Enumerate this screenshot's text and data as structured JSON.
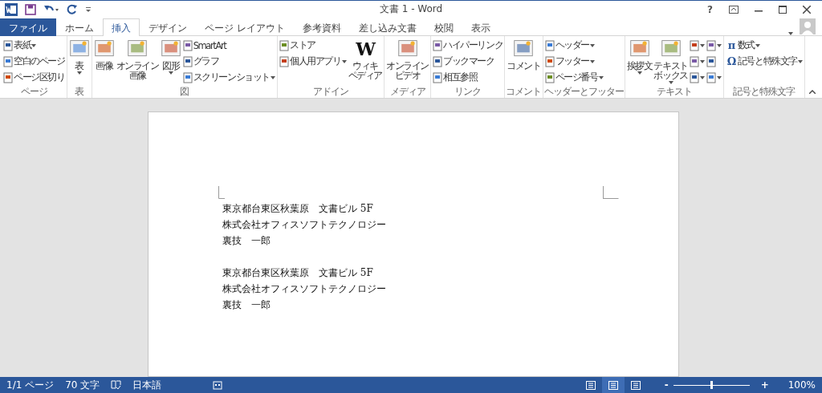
{
  "window": {
    "title": "文書 1 - Word",
    "help": "?"
  },
  "tabs": [
    {
      "label": "ファイル",
      "kind": "file",
      "selected": false
    },
    {
      "label": "ホーム",
      "kind": "tab",
      "selected": false
    },
    {
      "label": "挿入",
      "kind": "tab",
      "selected": true
    },
    {
      "label": "デザイン",
      "kind": "tab",
      "selected": false
    },
    {
      "label": "ページ レイアウト",
      "kind": "tab",
      "selected": false
    },
    {
      "label": "参考資料",
      "kind": "tab",
      "selected": false
    },
    {
      "label": "差し込み文書",
      "kind": "tab",
      "selected": false
    },
    {
      "label": "校閲",
      "kind": "tab",
      "selected": false
    },
    {
      "label": "表示",
      "kind": "tab",
      "selected": false
    }
  ],
  "ribbon": [
    {
      "label": "ページ",
      "columns": [
        {
          "kind": "stack",
          "items": [
            {
              "label": "表紙",
              "dropdown": true
            },
            {
              "label": "空白のページ",
              "dropdown": false
            },
            {
              "label": "ページ区切り",
              "dropdown": false
            }
          ]
        }
      ]
    },
    {
      "label": "表",
      "columns": [
        {
          "kind": "large",
          "lines": [
            "表"
          ],
          "dropdown": true
        }
      ]
    },
    {
      "label": "図",
      "columns": [
        {
          "kind": "large",
          "lines": [
            "画像"
          ],
          "dropdown": false
        },
        {
          "kind": "large",
          "lines": [
            "オンライン",
            "画像"
          ],
          "dropdown": false
        },
        {
          "kind": "large",
          "lines": [
            "図形"
          ],
          "dropdown": true
        },
        {
          "kind": "stack",
          "items": [
            {
              "label": "SmartArt",
              "dropdown": false
            },
            {
              "label": "グラフ",
              "dropdown": false
            },
            {
              "label": "スクリーンショット",
              "dropdown": true
            }
          ]
        }
      ]
    },
    {
      "label": "アドイン",
      "columns": [
        {
          "kind": "stack",
          "items": [
            {
              "label": "ストア",
              "dropdown": false
            },
            {
              "label": "個人用アプリ",
              "dropdown": true
            }
          ]
        },
        {
          "kind": "large",
          "glyph": "W",
          "lines": [
            "ウィキ",
            "ペディア"
          ],
          "dropdown": false
        }
      ]
    },
    {
      "label": "メディア",
      "columns": [
        {
          "kind": "large",
          "lines": [
            "オンライン",
            "ビデオ"
          ],
          "dropdown": false
        }
      ]
    },
    {
      "label": "リンク",
      "columns": [
        {
          "kind": "stack",
          "items": [
            {
              "label": "ハイパーリンク",
              "dropdown": false
            },
            {
              "label": "ブックマーク",
              "dropdown": false
            },
            {
              "label": "相互参照",
              "dropdown": false
            }
          ]
        }
      ]
    },
    {
      "label": "コメント",
      "columns": [
        {
          "kind": "large",
          "lines": [
            "コメント"
          ],
          "dropdown": false
        }
      ]
    },
    {
      "label": "ヘッダーとフッター",
      "columns": [
        {
          "kind": "stack",
          "items": [
            {
              "label": "ヘッダー",
              "dropdown": true
            },
            {
              "label": "フッター",
              "dropdown": true
            },
            {
              "label": "ページ番号",
              "dropdown": true
            }
          ]
        }
      ]
    },
    {
      "label": "テキスト",
      "columns": [
        {
          "kind": "large",
          "lines": [
            "挨拶文"
          ],
          "dropdown": true
        },
        {
          "kind": "large",
          "lines": [
            "テキスト",
            "ボックス"
          ],
          "dropdown": true
        },
        {
          "kind": "stack",
          "items": [
            {
              "dropdown": true
            },
            {
              "dropdown": true
            },
            {
              "dropdown": true
            }
          ]
        },
        {
          "kind": "stack",
          "items": [
            {
              "dropdown": true
            },
            {
              "dropdown": false
            },
            {
              "dropdown": true
            }
          ]
        }
      ]
    },
    {
      "label": "記号と特殊文字",
      "columns": [
        {
          "kind": "stack",
          "items": [
            {
              "glyph": "π",
              "label": "数式",
              "dropdown": true
            },
            {
              "glyph": "Ω",
              "label": "記号と特殊文字",
              "dropdown": true
            }
          ]
        }
      ]
    }
  ],
  "document": {
    "paragraphs": [
      [
        "東京都台東区秋葉原　文書ビル 5F",
        "株式会社オフィスソフトテクノロジー",
        "裏技　一郎"
      ],
      [
        "東京都台東区秋葉原　文書ビル 5F",
        "株式会社オフィスソフトテクノロジー",
        "裏技　一郎"
      ]
    ]
  },
  "status_bar": {
    "page": "1/1 ページ",
    "words": "70 文字",
    "language": "日本語",
    "views": [
      {
        "selected": false
      },
      {
        "selected": true
      },
      {
        "selected": false
      }
    ],
    "zoom": {
      "minus": "-",
      "plus": "+",
      "level": 0.5,
      "reading": "100%"
    }
  }
}
